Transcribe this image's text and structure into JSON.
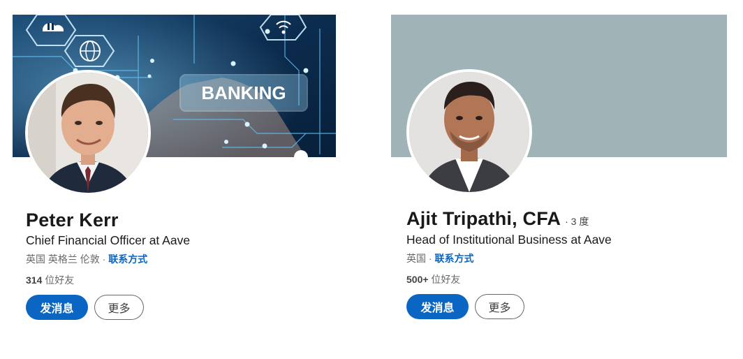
{
  "profiles": [
    {
      "name": "Peter Kerr",
      "degree": "",
      "headline": "Chief Financial Officer at Aave",
      "location": "英国 英格兰 伦敦",
      "separator": " · ",
      "contact_label": "联系方式",
      "connections_count": "314",
      "connections_label": " 位好友",
      "message_label": "发消息",
      "more_label": "更多",
      "cover_text": "BANKING",
      "cover_color": "#0b2f52"
    },
    {
      "name": "Ajit Tripathi, CFA",
      "degree": "· 3 度",
      "headline": "Head of Institutional Business at Aave",
      "location": "英国",
      "separator": " · ",
      "contact_label": "联系方式",
      "connections_count": "500+",
      "connections_label": " 位好友",
      "message_label": "发消息",
      "more_label": "更多",
      "cover_color": "#a0b4b7"
    }
  ],
  "colors": {
    "accent": "#0a66c2",
    "text_primary": "#000000e6",
    "text_secondary": "#00000099"
  }
}
